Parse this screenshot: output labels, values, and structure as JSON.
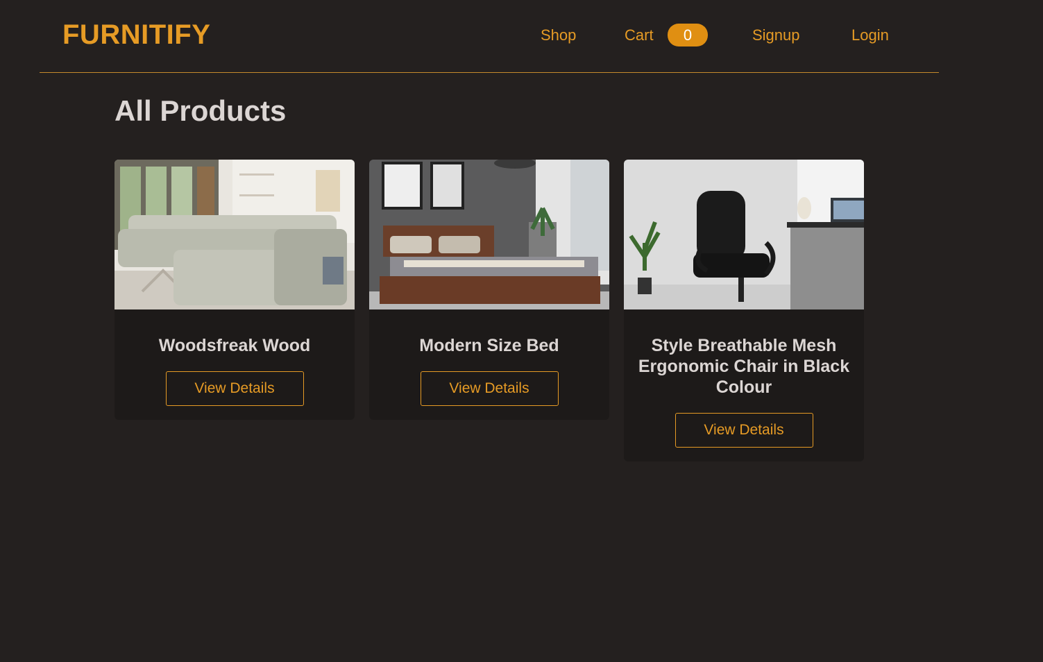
{
  "header": {
    "logo": "FURNITIFY",
    "nav": {
      "shop": "Shop",
      "cart": "Cart",
      "cart_count": "0",
      "signup": "Signup",
      "login": "Login"
    }
  },
  "main": {
    "title": "All Products",
    "products": [
      {
        "name": "Woodsfreak Wood",
        "button": "View Details",
        "image": "sofa-image"
      },
      {
        "name": "Modern Size Bed",
        "button": "View Details",
        "image": "bed-image"
      },
      {
        "name": "Style Breathable Mesh Ergonomic Chair in Black Colour",
        "button": "View Details",
        "image": "chair-image"
      }
    ]
  },
  "colors": {
    "background": "#24201f",
    "accent": "#e69b25",
    "card": "#1d1a19",
    "title_text": "#dcd6d4"
  }
}
